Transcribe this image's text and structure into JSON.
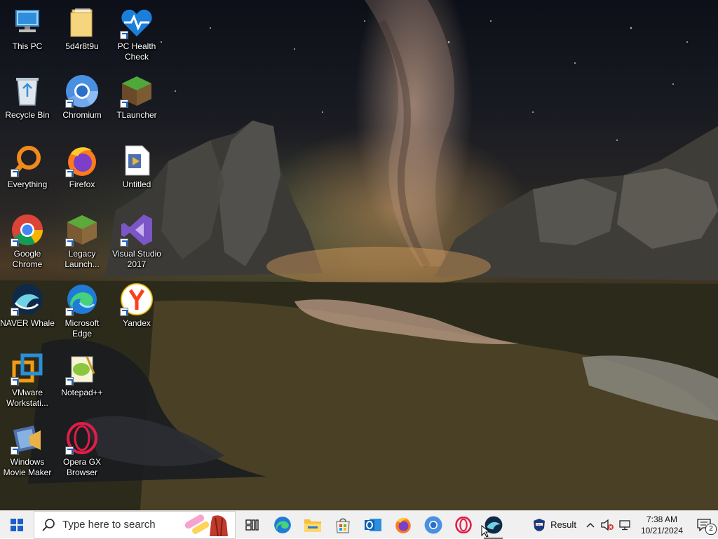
{
  "desktop": {
    "icons": [
      {
        "label": "This PC",
        "icon": "this-pc-icon"
      },
      {
        "label": "5d4r8t9u",
        "icon": "folder-icon"
      },
      {
        "label": "PC Health Check",
        "icon": "pc-health-check-icon"
      },
      {
        "label": "Recycle Bin",
        "icon": "recycle-bin-icon"
      },
      {
        "label": "Chromium",
        "icon": "chromium-icon"
      },
      {
        "label": "TLauncher",
        "icon": "tlauncher-icon"
      },
      {
        "label": "Everything",
        "icon": "everything-icon"
      },
      {
        "label": "Firefox",
        "icon": "firefox-icon"
      },
      {
        "label": "Untitled",
        "icon": "video-file-icon"
      },
      {
        "label": "Google Chrome",
        "icon": "chrome-icon"
      },
      {
        "label": "Legacy Launch...",
        "icon": "legacy-launcher-icon"
      },
      {
        "label": "Visual Studio 2017",
        "icon": "visual-studio-icon"
      },
      {
        "label": "NAVER Whale",
        "icon": "naver-whale-icon"
      },
      {
        "label": "Microsoft Edge",
        "icon": "edge-icon"
      },
      {
        "label": "Yandex",
        "icon": "yandex-icon"
      },
      {
        "label": "VMware Workstati...",
        "icon": "vmware-icon"
      },
      {
        "label": "Notepad++",
        "icon": "notepad-plus-plus-icon"
      },
      {
        "label": "Windows Movie Maker",
        "icon": "movie-maker-icon"
      },
      {
        "label": "Opera GX Browser",
        "icon": "opera-gx-icon"
      }
    ]
  },
  "taskbar": {
    "search_placeholder": "Type here to search",
    "apps": [
      "task-view-icon",
      "edge-icon",
      "file-explorer-icon",
      "microsoft-store-icon",
      "outlook-icon",
      "firefox-icon",
      "chromium-icon",
      "opera-icon",
      "naver-whale-icon"
    ],
    "weather_label": "Result",
    "time": "7:38 AM",
    "date": "10/21/2024",
    "notification_count": "2"
  }
}
